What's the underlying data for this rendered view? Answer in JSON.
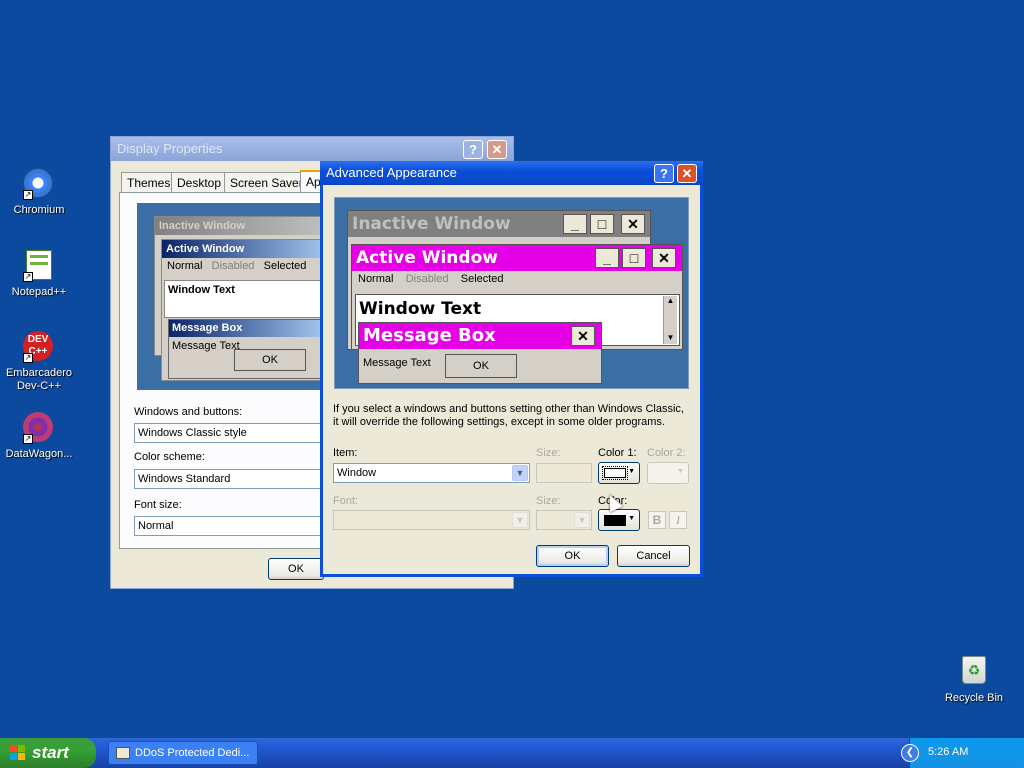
{
  "desktop": {
    "icons": [
      {
        "label": "Chromium"
      },
      {
        "label": "Notepad++"
      },
      {
        "label": "Embarcadero Dev-C++"
      },
      {
        "label": "DataWagon..."
      },
      {
        "label": "Recycle Bin"
      }
    ]
  },
  "display_properties": {
    "title": "Display Properties",
    "tabs": [
      "Themes",
      "Desktop",
      "Screen Saver",
      "Ap"
    ],
    "preview": {
      "inactive_window": "Inactive Window",
      "active_window": "Active Window",
      "menu_normal": "Normal",
      "menu_disabled": "Disabled",
      "menu_selected": "Selected",
      "window_text": "Window Text",
      "message_box": "Message Box",
      "message_text": "Message Text",
      "ok": "OK"
    },
    "windows_buttons_label": "Windows and buttons:",
    "windows_buttons_value": "Windows Classic style",
    "color_scheme_label": "Color scheme:",
    "color_scheme_value": "Windows Standard",
    "font_size_label": "Font size:",
    "font_size_value": "Normal",
    "ok": "OK"
  },
  "advanced": {
    "title": "Advanced Appearance",
    "preview": {
      "inactive_window": "Inactive Window",
      "active_window": "Active Window",
      "menu_normal": "Normal",
      "menu_disabled": "Disabled",
      "menu_selected": "Selected",
      "window_text": "Window Text",
      "message_box": "Message Box",
      "message_text": "Message Text",
      "ok": "OK"
    },
    "info_text": "If you select a windows and buttons setting other than Windows Classic, it will override the following settings, except in some older programs.",
    "item_label": "Item:",
    "item_value": "Window",
    "size_label": "Size:",
    "color1_label": "Color 1:",
    "color2_label": "Color 2:",
    "font_label": "Font:",
    "font_size_label": "Size:",
    "color_label": "Color:",
    "bold": "B",
    "italic": "I",
    "ok": "OK",
    "cancel": "Cancel"
  },
  "taskbar": {
    "start": "start",
    "task": "DDoS Protected Dedi...",
    "clock": "5:26 AM"
  },
  "colors": {
    "desktop": "#0c4aa0",
    "preview_active": "#e600e6",
    "preview_inactive": "#808080"
  }
}
